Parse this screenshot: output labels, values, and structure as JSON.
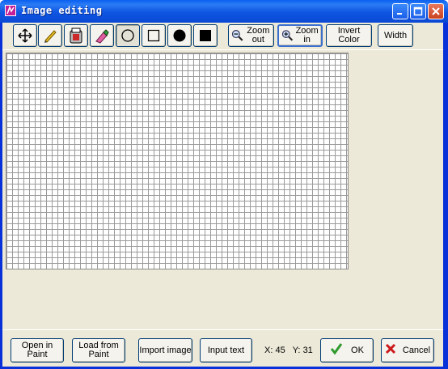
{
  "window": {
    "title": "Image editing"
  },
  "toolbar": {
    "zoom_out_label": "Zoom out",
    "zoom_in_label": "Zoom in",
    "invert_color_label": "Invert Color",
    "width_label": "Width"
  },
  "status": {
    "x_label": "X:",
    "x_value": "45",
    "y_label": "Y:",
    "y_value": "31"
  },
  "footer": {
    "open_in_paint_label": "Open in Paint",
    "load_from_paint_label": "Load from Paint",
    "import_image_label": "Import image",
    "input_text_label": "Input text",
    "ok_label": "OK",
    "cancel_label": "Cancel"
  },
  "icons": {
    "tools": [
      "move-icon",
      "pencil-icon",
      "bucket-fill-icon",
      "eraser-icon",
      "ellipse-outline-icon",
      "rectangle-outline-icon",
      "ellipse-filled-icon",
      "rectangle-filled-icon"
    ],
    "zoom_out": "zoom-out-icon",
    "zoom_in": "zoom-in-icon",
    "ok": "checkmark-icon",
    "cancel": "x-mark-icon"
  },
  "colors": {
    "title_bar": "#0a5ff0",
    "window_frame": "#0831d9",
    "client_bg": "#ece9d8",
    "grid_line": "#9a9a9a",
    "ok_check": "#2e9b2e",
    "cancel_x": "#cc1a1a"
  }
}
